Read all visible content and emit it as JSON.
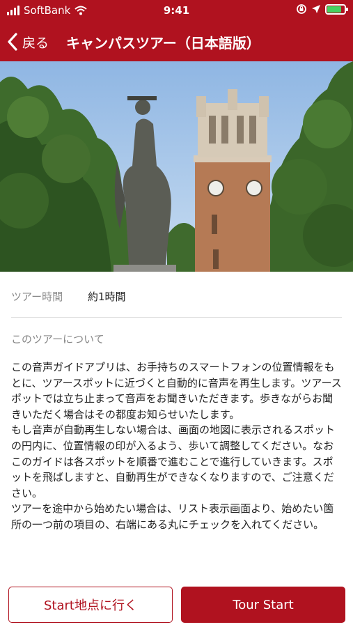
{
  "status_bar": {
    "carrier": "SoftBank",
    "time": "9:41",
    "battery_level": 0.85,
    "colors": {
      "bar": "#b0121f",
      "battery": "#46d160"
    }
  },
  "nav": {
    "back_label": "戻る",
    "title": "キャンパスツアー（日本語版）"
  },
  "tour": {
    "duration_label": "ツアー時間",
    "duration_value": "約1時間",
    "about_title": "このツアーについて",
    "description": "この音声ガイドアプリは、お手持ちのスマートフォンの位置情報をもとに、ツアースポットに近づくと自動的に音声を再生します。ツアースポットでは立ち止まって音声をお聞きいただきます。歩きながらお聞きいただく場合はその都度お知らせいたします。\nもし音声が自動再生しない場合は、画面の地図に表示されるスポットの円内に、位置情報の印が入るよう、歩いて調整してください。なおこのガイドは各スポットを順番で進むことで進行していきます。スポットを飛ばしますと、自動再生ができなくなりますので、ご注意ください。\nツアーを途中から始めたい場合は、リスト表示画面より、始めたい箇所の一つ前の項目の、右端にある丸にチェックを入れてください。"
  },
  "buttons": {
    "start_point": "Start地点に行く",
    "tour_start": "Tour Start"
  },
  "icons": {
    "back": "chevron-left-icon",
    "wifi": "wifi-icon",
    "location": "location-arrow-icon",
    "lock": "orientation-lock-icon"
  }
}
